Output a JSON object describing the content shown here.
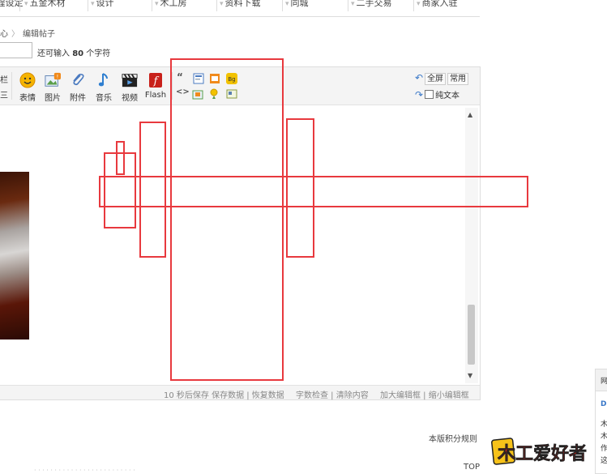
{
  "nav": {
    "items": [
      "流程设定",
      "五金木材",
      "设计",
      "木工房",
      "资料下载",
      "同城",
      "二手交易",
      "商家入驻"
    ]
  },
  "breadcrumb": {
    "items": [
      "心",
      "编辑帖子"
    ]
  },
  "subject": {
    "counter_prefix": "还可输入",
    "counter_value": "80",
    "counter_suffix": "个字符"
  },
  "toolbar": {
    "cut_left_top": "栏",
    "cut_left_bottom": "三",
    "emoji": "表情",
    "image": "图片",
    "attach": "附件",
    "music": "音乐",
    "video": "视频",
    "flash": "Flash",
    "quote_glyph": "“",
    "code_glyph": "<>",
    "bg_glyph": "Bg",
    "fullscreen": "全屏",
    "common": "常用",
    "plain_text": "纯文本"
  },
  "statusbar": {
    "autosave": "10 秒后保存 保存数据 | 恢复数据",
    "check": "字数检查 | 清除内容",
    "resize": "加大编辑框 | 缩小编辑框"
  },
  "footer": {
    "board_rules": "本版积分规则",
    "top": "TOP"
  },
  "logo": {
    "text": "木工爱好者"
  },
  "side_panel": {
    "header": "网",
    "lines": [
      "D",
      "木",
      "木",
      "作",
      "这"
    ]
  },
  "colors": {
    "overlay_red": "#e8393e",
    "logo_red": "#d32018",
    "logo_yellow": "#f7c21a"
  }
}
